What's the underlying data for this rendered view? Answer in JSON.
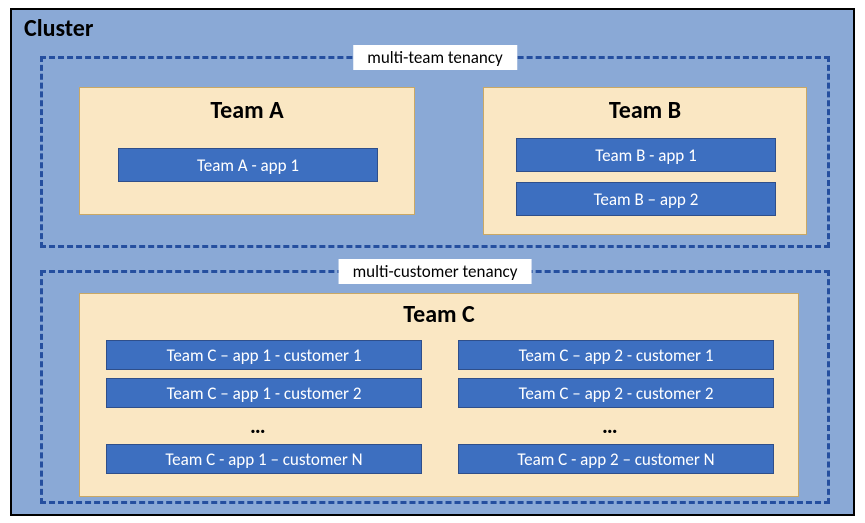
{
  "cluster": {
    "title": "Cluster"
  },
  "region1": {
    "label": "multi-team tenancy"
  },
  "region2": {
    "label": "multi-customer tenancy"
  },
  "teamA": {
    "title": "Team A",
    "app1": "Team A - app 1"
  },
  "teamB": {
    "title": "Team B",
    "app1": "Team B - app 1",
    "app2": "Team B – app 2"
  },
  "teamC": {
    "title": "Team C",
    "col1": {
      "r1": "Team C – app 1 - customer 1",
      "r2": "Team C – app 1 - customer 2",
      "ell": "…",
      "rN": "Team C - app 1 – customer N"
    },
    "col2": {
      "r1": "Team C – app 2 - customer 1",
      "r2": "Team C – app 2 - customer 2",
      "ell": "…",
      "rN": "Team C - app 2 – customer N"
    }
  }
}
